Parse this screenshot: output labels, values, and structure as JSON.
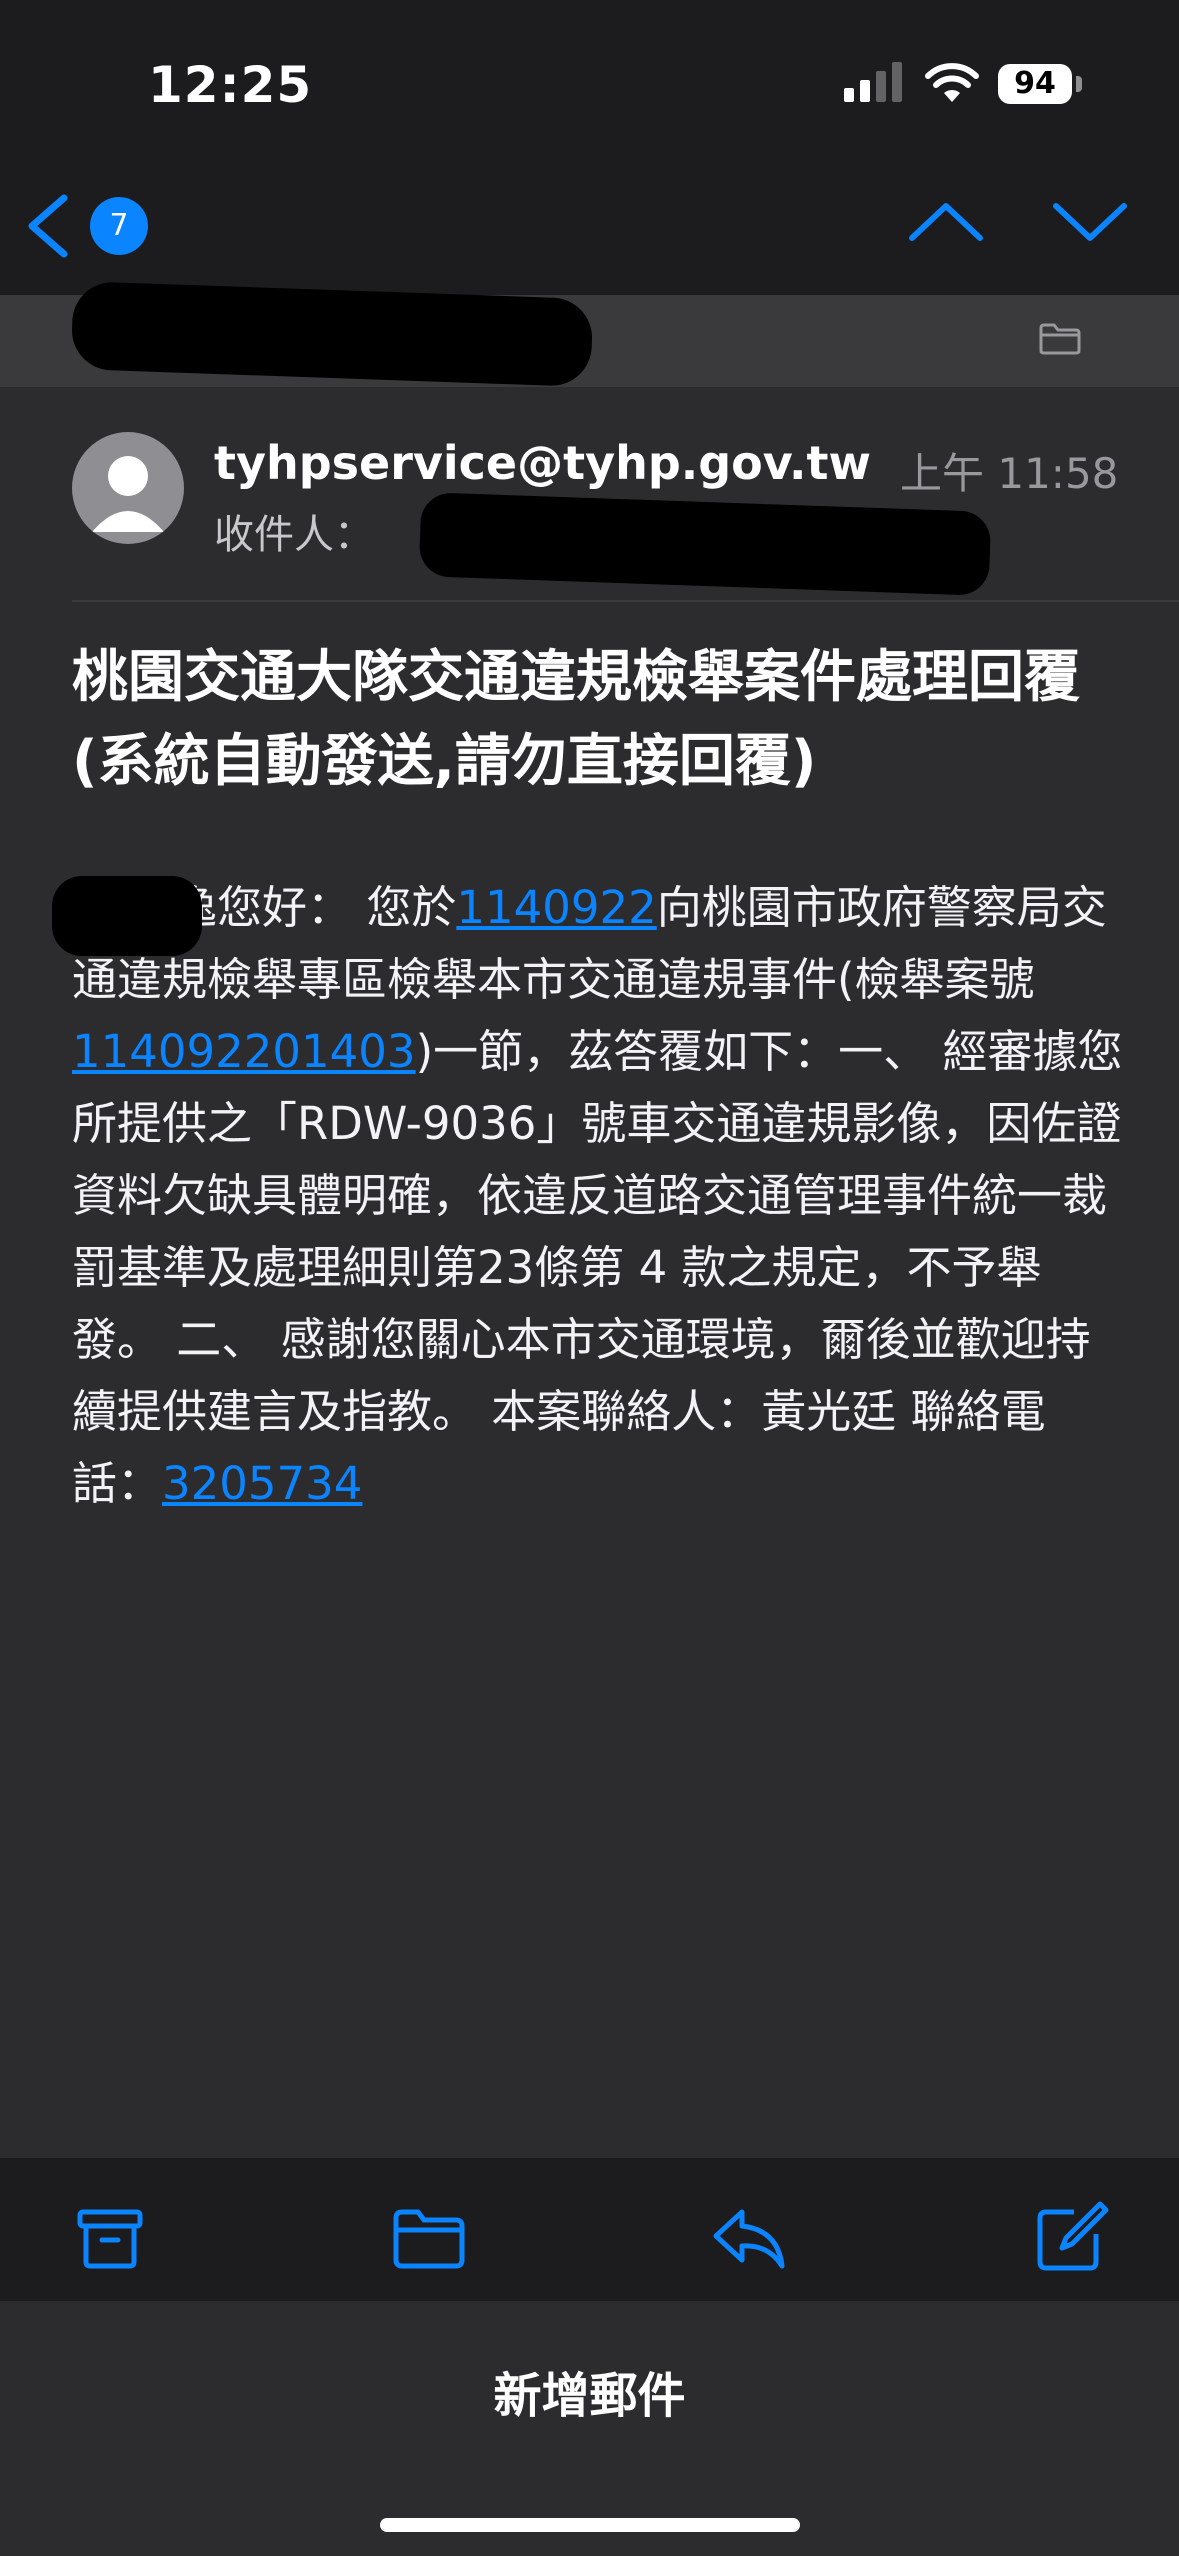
{
  "status_bar": {
    "time": "12:25",
    "battery": "94"
  },
  "nav": {
    "unread_count": "7"
  },
  "email": {
    "sender": "tyhpservice@tyhp.gov.tw",
    "time": "上午 11:58",
    "recipient_label": "收件人：",
    "subject": "桃園交通大隊交通違規檢舉案件處理回覆 (系統自動發送,請勿直接回覆)",
    "body": {
      "greeting_suffix": "逸您好：",
      "part1": "您於",
      "date_link": "1140922",
      "part2": "向桃園市政府警察局交通違規檢舉專區檢舉本市交通違規事件(檢舉案號",
      "case_link": "114092201403",
      "part3": ")一節，茲答覆如下：一、 經審據您所提供之「RDW-9036」號車交通違規影像，因佐證資料欠缺具體明確，依違反道路交通管理事件統一裁罰基準及處理細則第23條第 4 款之規定，不予舉發。 二、 感謝您關心本市交通環境，爾後並歡迎持續提供建言及指教。 本案聯絡人：黃光廷 聯絡電話：",
      "phone_link": "3205734"
    }
  },
  "bottom": {
    "new_mail_label": "新增郵件"
  },
  "colors": {
    "accent": "#0a84ff",
    "background": "#2c2c2e",
    "bar": "#1c1c1e"
  }
}
